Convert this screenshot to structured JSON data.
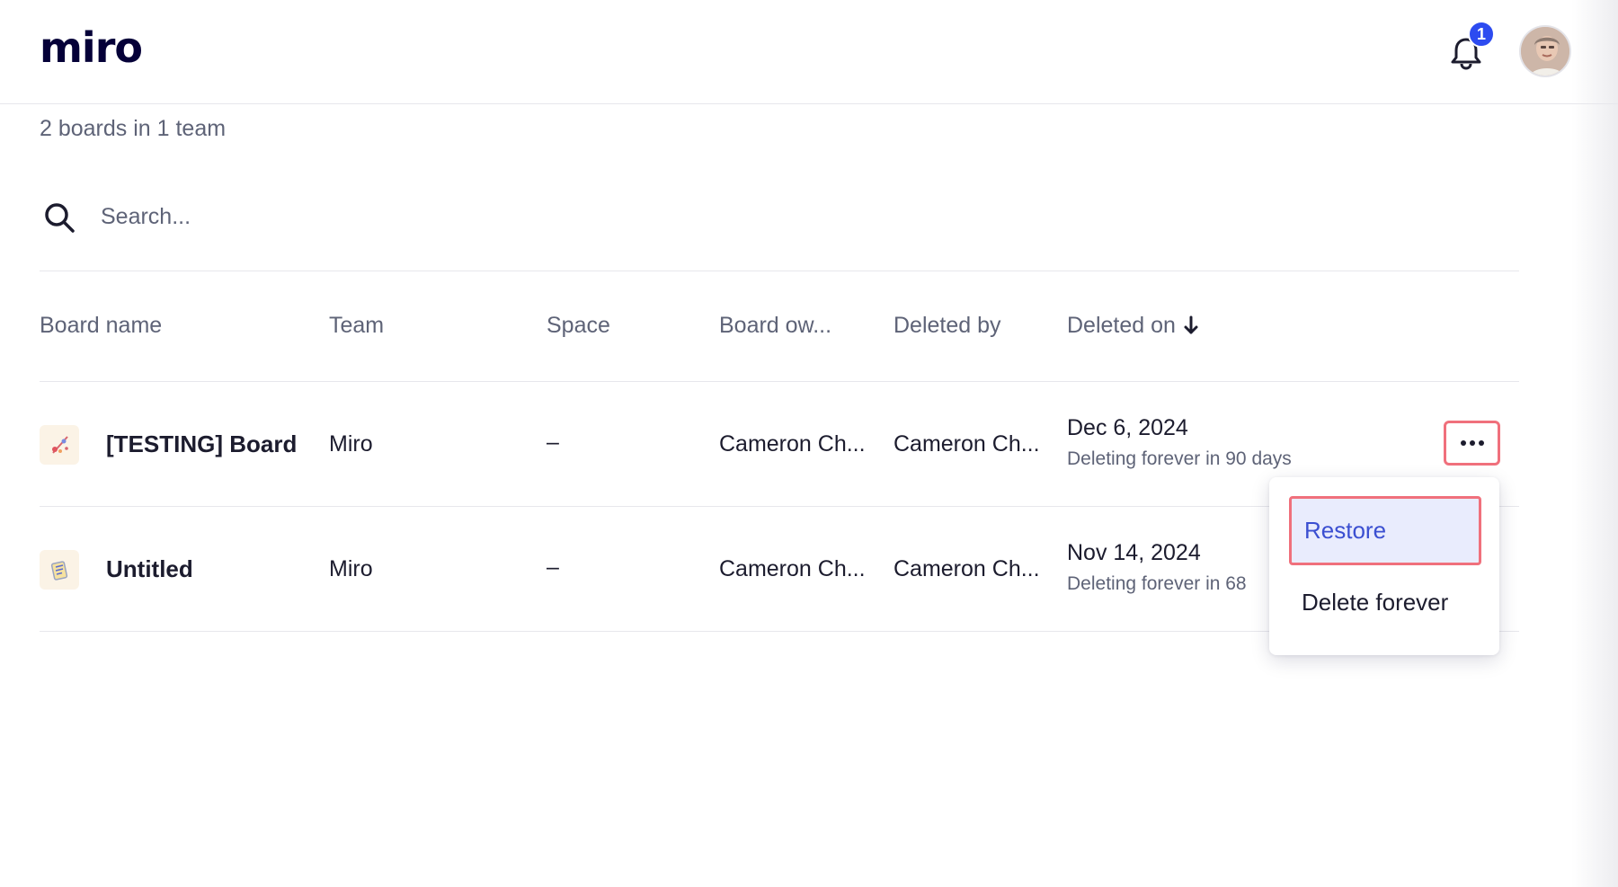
{
  "header": {
    "logo": "miro",
    "notification_count": "1",
    "icons": {
      "bell": "bell-icon",
      "avatar": "user-avatar"
    }
  },
  "summary": "2 boards in 1 team",
  "search": {
    "placeholder": "Search...",
    "value": ""
  },
  "table": {
    "columns": [
      "Board name",
      "Team",
      "Space",
      "Board ow...",
      "Deleted by",
      "Deleted on"
    ],
    "sort_column": "Deleted on",
    "rows": [
      {
        "board_name": "[TESTING] Board",
        "team": "Miro",
        "space": "–",
        "board_owner": "Cameron Ch...",
        "deleted_by": "Cameron Ch...",
        "deleted_on": "Dec 6, 2024",
        "deleting_note": "Deleting forever in 90 days"
      },
      {
        "board_name": "Untitled",
        "team": "Miro",
        "space": "–",
        "board_owner": "Cameron Ch...",
        "deleted_by": "Cameron Ch...",
        "deleted_on": "Nov 14, 2024",
        "deleting_note": "Deleting forever in 68"
      }
    ]
  },
  "menu": {
    "items": [
      "Restore",
      "Delete forever"
    ]
  },
  "colors": {
    "accent": "#2d4bf0",
    "highlight_border": "#f0707c",
    "menu_selected_bg": "#e9ecfd",
    "menu_selected_text": "#3b4fd1"
  }
}
